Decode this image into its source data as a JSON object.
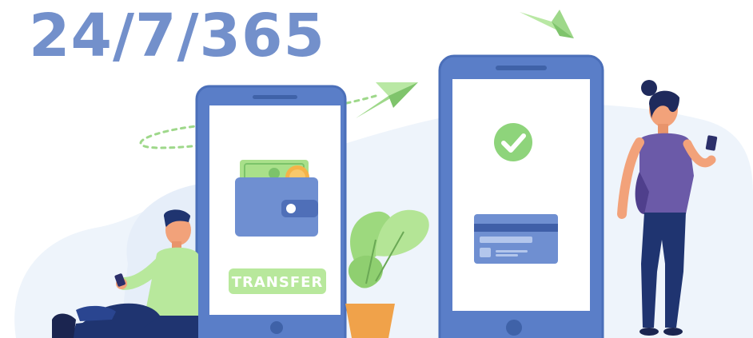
{
  "headline": {
    "text": "24/7/365",
    "color": "#7390cb"
  },
  "illustration": {
    "left_phone_button_label": "TRANSFER",
    "colors": {
      "phone_body": "#5a7ec8",
      "phone_edge": "#4b6fb9",
      "screen": "#ffffff",
      "accent_green": "#a9e08a",
      "check_green": "#8ed47b",
      "wallet_blue": "#6f8fd1",
      "coin_orange": "#f5b348",
      "plant_green": "#9dd97e",
      "pot_orange": "#f0a24a",
      "woman_shirt": "#6b5aa8",
      "man_shirt": "#b8e89c",
      "pants_navy": "#1f3470",
      "background_blob": "#eef4fb"
    }
  }
}
